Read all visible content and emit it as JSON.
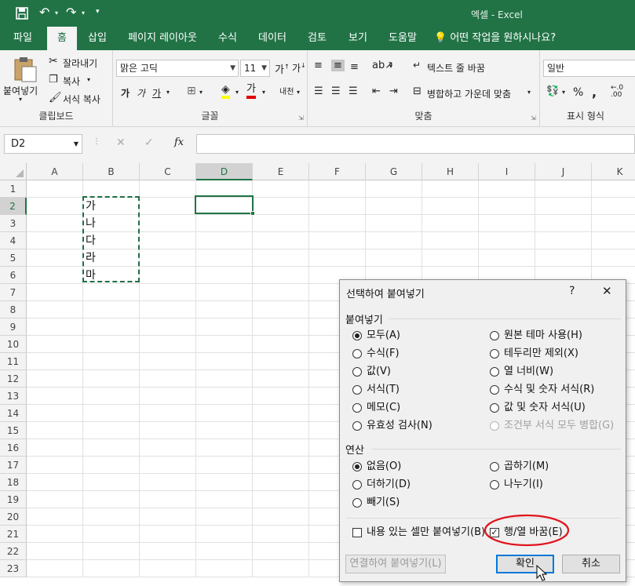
{
  "titlebar": {
    "title": "엑셀  -  Excel"
  },
  "tabs": [
    "파일",
    "홈",
    "삽입",
    "페이지 레이아웃",
    "수식",
    "데이터",
    "검토",
    "보기",
    "도움말",
    "어떤 작업을 원하시나요?"
  ],
  "ribbon": {
    "clipboard": {
      "paste": "붙여넣기",
      "cut": "잘라내기",
      "copy": "복사",
      "format_painter": "서식 복사",
      "label": "클립보드"
    },
    "font": {
      "name": "맑은 고딕",
      "size": "11",
      "bold": "가",
      "italic": "가",
      "underline": "가",
      "font_color": "가",
      "phonetic": "내천",
      "label": "글꼴"
    },
    "alignment": {
      "wrap": "텍스트 줄 바꿈",
      "merge": "병합하고 가운데 맞춤",
      "label": "맞춤"
    },
    "number": {
      "format": "일반",
      "percent": "%",
      "comma": ",",
      "label": "표시 형식"
    }
  },
  "formula_bar": {
    "name_box": "D2",
    "fx": "fx",
    "cancel": "✕",
    "enter": "✓"
  },
  "sheet": {
    "columns": [
      "A",
      "B",
      "C",
      "D",
      "E",
      "F",
      "G",
      "H",
      "I",
      "J",
      "K"
    ],
    "rows": [
      "1",
      "2",
      "3",
      "4",
      "5",
      "6",
      "7",
      "8",
      "9",
      "10",
      "11",
      "12",
      "13",
      "14",
      "15",
      "16",
      "17",
      "18",
      "19",
      "20",
      "21",
      "22",
      "23"
    ],
    "cells": [
      {
        "ref": "B2",
        "value": "가"
      },
      {
        "ref": "B3",
        "value": "나"
      },
      {
        "ref": "B4",
        "value": "다"
      },
      {
        "ref": "B5",
        "value": "라"
      },
      {
        "ref": "B6",
        "value": "마"
      }
    ]
  },
  "dialog": {
    "title": "선택하여 붙여넣기",
    "help": "?",
    "close": "✕",
    "paste_section": "붙여넣기",
    "paste_options_left": [
      "모두(A)",
      "수식(F)",
      "값(V)",
      "서식(T)",
      "메모(C)",
      "유효성 검사(N)"
    ],
    "paste_options_right": [
      "원본 테마 사용(H)",
      "테두리만 제외(X)",
      "열 너비(W)",
      "수식 및 숫자 서식(R)",
      "값 및 숫자 서식(U)",
      "조건부 서식 모두 병합(G)"
    ],
    "operation_section": "연산",
    "operation_left": [
      "없음(O)",
      "더하기(D)",
      "빼기(S)"
    ],
    "operation_right": [
      "곱하기(M)",
      "나누기(I)"
    ],
    "skip_blanks": "내용 있는 셀만 붙여넣기(B)",
    "transpose": "행/열 바꿈(E)",
    "paste_link": "연결하여 붙여넣기(L)",
    "ok": "확인",
    "cancel": "취소"
  },
  "colors": {
    "excel_green": "#217346",
    "annotation_red": "#e0141e"
  }
}
